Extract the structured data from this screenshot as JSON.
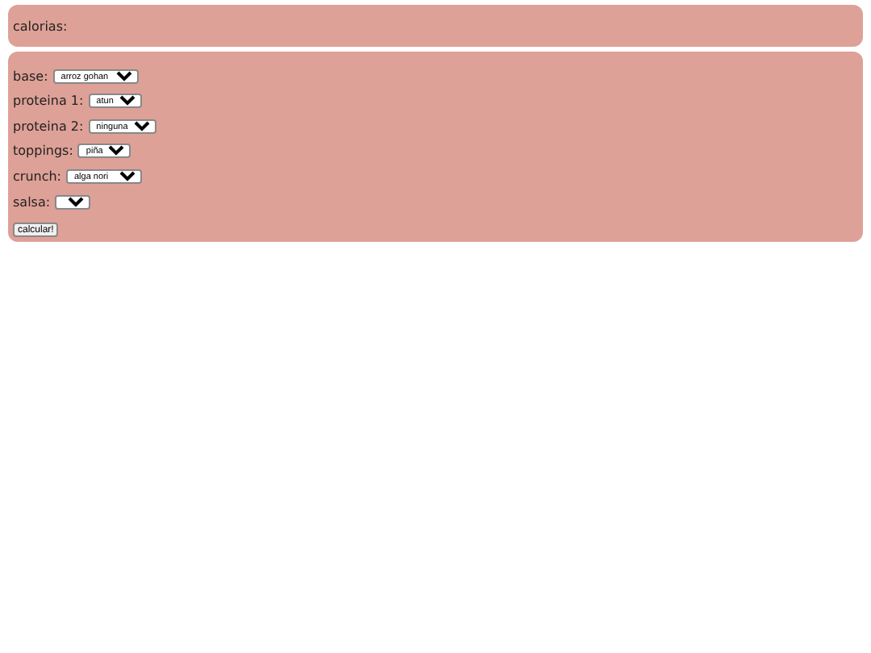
{
  "result": {
    "label": "calorias:"
  },
  "fields": [
    {
      "label": "base:",
      "value": "arroz gohan"
    },
    {
      "label": "proteina 1:",
      "value": "atun"
    },
    {
      "label": "proteina 2:",
      "value": "ninguna"
    },
    {
      "label": "toppings:",
      "value": "piña"
    },
    {
      "label": "crunch:",
      "value": "alga nori"
    },
    {
      "label": "salsa:"
    }
  ],
  "button": "calcular!"
}
